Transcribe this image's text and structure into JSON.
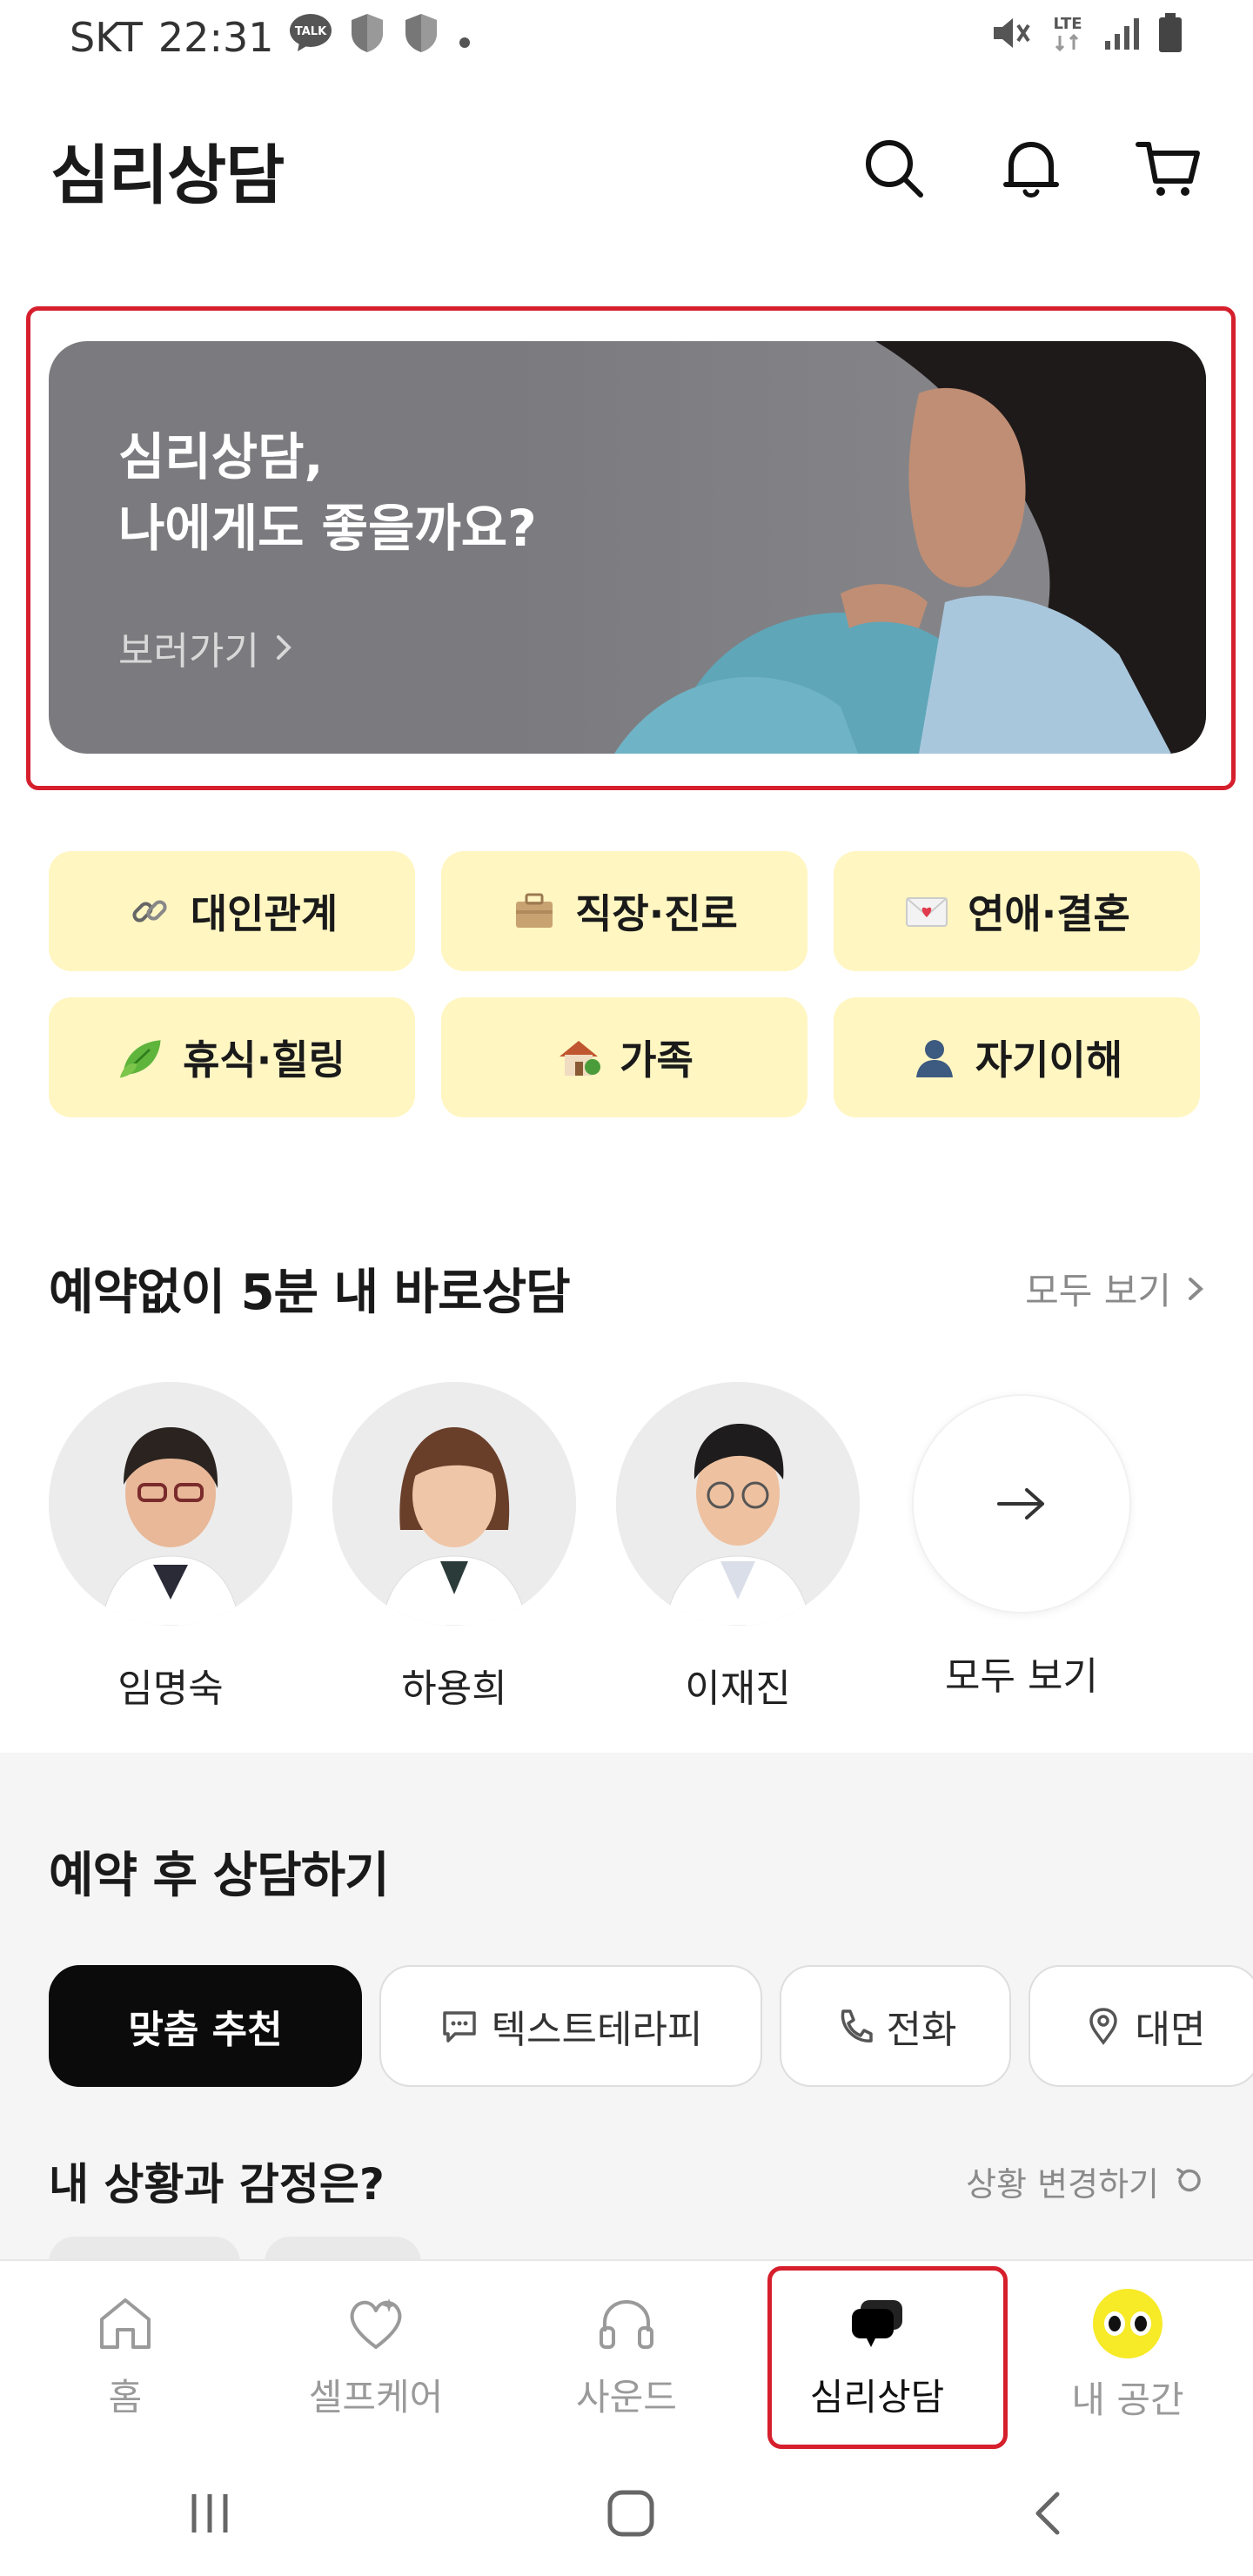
{
  "status_bar": {
    "carrier": "SKT",
    "time": "22:31",
    "talk_badge": "TALK",
    "lte": "LTE"
  },
  "header": {
    "title": "심리상담"
  },
  "banner": {
    "headline_line1": "심리상담,",
    "headline_line2": "나에게도 좋을까요?",
    "cta": "보러가기"
  },
  "categories": [
    {
      "label": "대인관계",
      "icon": "link-icon"
    },
    {
      "label": "직장·진로",
      "icon": "briefcase-icon"
    },
    {
      "label": "연애·결혼",
      "icon": "love-letter-icon"
    },
    {
      "label": "휴식·힐링",
      "icon": "leaf-icon"
    },
    {
      "label": "가족",
      "icon": "house-icon"
    },
    {
      "label": "자기이해",
      "icon": "person-icon"
    }
  ],
  "quick": {
    "title": "예약없이 5분 내 바로상담",
    "see_all": "모두 보기",
    "counselors": [
      {
        "name": "임명숙"
      },
      {
        "name": "하용희"
      },
      {
        "name": "이재진"
      }
    ],
    "more_label": "모두 보기"
  },
  "reserve": {
    "title": "예약 후 상담하기",
    "filters": [
      "맞춤 추천",
      "텍스트테라피",
      "전화",
      "대면"
    ],
    "situation_q": "내 상황과 감정은?",
    "situation_change": "상황 변경하기"
  },
  "bottom_nav": [
    "홈",
    "셀프케어",
    "사운드",
    "심리상담",
    "내 공간"
  ],
  "colors": {
    "accent_yellow": "#fff6c2",
    "highlight_red": "#d61f2c",
    "banner_bg": "#7b7b7f"
  }
}
